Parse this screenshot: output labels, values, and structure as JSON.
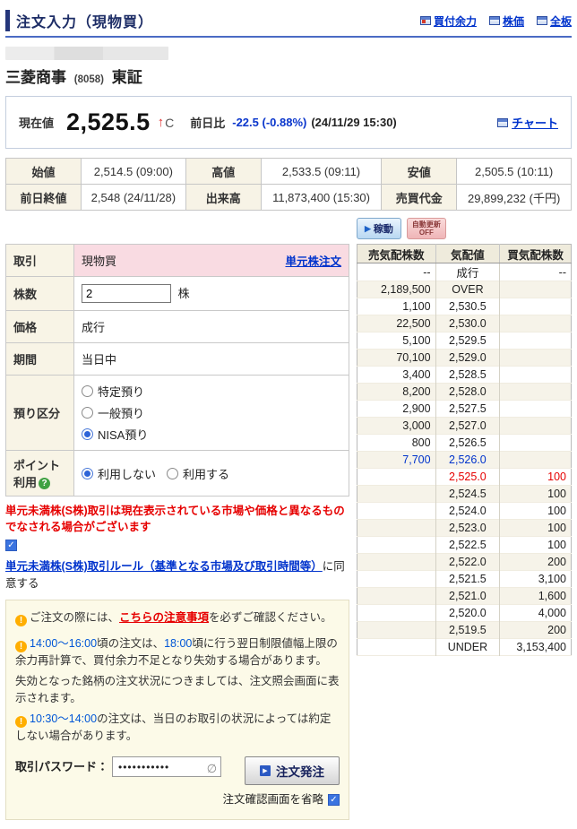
{
  "header": {
    "title": "注文入力（現物買）",
    "links": [
      {
        "label": "買付余力",
        "cls": "win-red"
      },
      {
        "label": "株価",
        "cls": ""
      },
      {
        "label": "全板",
        "cls": ""
      }
    ]
  },
  "stock": {
    "name": "三菱商事",
    "code": "(8058)",
    "market": "東証"
  },
  "price": {
    "current_label": "現在値",
    "value": "2,525.5",
    "tick_arrow": "↑",
    "tick_flag": "C",
    "change_label": "前日比",
    "change": "-22.5 (-0.88%)",
    "timestamp": "(24/11/29 15:30)",
    "chart_link": "チャート"
  },
  "quote": {
    "rows": [
      [
        "始値",
        "2,514.5 (09:00)",
        "高値",
        "2,533.5 (09:11)",
        "安値",
        "2,505.5 (10:11)"
      ],
      [
        "前日終値",
        "2,548 (24/11/28)",
        "出来高",
        "11,873,400 (15:30)",
        "売買代金",
        "29,899,232 (千円)"
      ]
    ]
  },
  "controls": {
    "run_label": "稼動",
    "auto_update_line1": "自動更新",
    "auto_update_line2": "OFF"
  },
  "form": {
    "trade_label": "取引",
    "trade_value": "現物買",
    "unit_order_link": "単元株注文",
    "qty_label": "株数",
    "qty_value": "2",
    "qty_unit": "株",
    "price_label": "価格",
    "price_value": "成行",
    "period_label": "期間",
    "period_value": "当日中",
    "deposit_label": "預り区分",
    "deposit_options": [
      {
        "label": "特定預り",
        "cls": ""
      },
      {
        "label": "一般預り",
        "cls": ""
      },
      {
        "label": "NISA預り",
        "cls": "checked"
      }
    ],
    "point_label": "ポイント利用",
    "point_help": "?",
    "point_options": [
      {
        "label": "利用しない",
        "cls": "checked"
      },
      {
        "label": "利用する",
        "cls": ""
      }
    ]
  },
  "warning": {
    "text": "単元未満株(S株)取引は現在表示されている市場や価格と異なるものでなされる場合がございます"
  },
  "agreement": {
    "link": "単元未満株(S株)取引ルール（基準となる市場及び取引時間等）",
    "suffix": "に同意する"
  },
  "notes": {
    "line1_pre": "ご注文の際には、",
    "line1_link": "こちらの注意事項",
    "line1_post": "を必ずご確認ください。",
    "line2_time1": "14:00～16:00",
    "line2_a": "頃の注文は、",
    "line2_time2": "18:00",
    "line2_b": "頃に行う翌日制限値幅上限の余力再計算で、買付余力不足となり失効する場合があります。",
    "line3": "失効となった銘柄の注文状況につきましては、注文照会画面に表示されます。",
    "line4_time": "10:30～14:00",
    "line4_a": "の注文は、当日のお取引の状況によっては約定しない場合があります。"
  },
  "submit": {
    "password_label": "取引パスワード：",
    "password_value": "•••••••••••",
    "eye_icon": "∅",
    "submit_label": "注文発注",
    "skip_confirm_label": "注文確認画面を省略"
  },
  "order_book": {
    "headers": {
      "sell": "売気配株数",
      "price": "気配値",
      "buy": "買気配株数"
    },
    "rows": [
      {
        "sell": "--",
        "price": "成行",
        "buy": "--",
        "cls": ""
      },
      {
        "sell": "2,189,500",
        "price": "OVER",
        "buy": "",
        "cls": ""
      },
      {
        "sell": "1,100",
        "price": "2,530.5",
        "buy": "",
        "cls": ""
      },
      {
        "sell": "22,500",
        "price": "2,530.0",
        "buy": "",
        "cls": ""
      },
      {
        "sell": "5,100",
        "price": "2,529.5",
        "buy": "",
        "cls": ""
      },
      {
        "sell": "70,100",
        "price": "2,529.0",
        "buy": "",
        "cls": ""
      },
      {
        "sell": "3,400",
        "price": "2,528.5",
        "buy": "",
        "cls": ""
      },
      {
        "sell": "8,200",
        "price": "2,528.0",
        "buy": "",
        "cls": ""
      },
      {
        "sell": "2,900",
        "price": "2,527.5",
        "buy": "",
        "cls": ""
      },
      {
        "sell": "3,000",
        "price": "2,527.0",
        "buy": "",
        "cls": ""
      },
      {
        "sell": "800",
        "price": "2,526.5",
        "buy": "",
        "cls": ""
      },
      {
        "sell": "7,700",
        "price": "2,526.0",
        "buy": "",
        "cls": "best-ask"
      },
      {
        "sell": "",
        "price": "2,525.0",
        "buy": "100",
        "cls": "best-bid"
      },
      {
        "sell": "",
        "price": "2,524.5",
        "buy": "100",
        "cls": ""
      },
      {
        "sell": "",
        "price": "2,524.0",
        "buy": "100",
        "cls": ""
      },
      {
        "sell": "",
        "price": "2,523.0",
        "buy": "100",
        "cls": ""
      },
      {
        "sell": "",
        "price": "2,522.5",
        "buy": "100",
        "cls": ""
      },
      {
        "sell": "",
        "price": "2,522.0",
        "buy": "200",
        "cls": ""
      },
      {
        "sell": "",
        "price": "2,521.5",
        "buy": "3,100",
        "cls": ""
      },
      {
        "sell": "",
        "price": "2,521.0",
        "buy": "1,600",
        "cls": ""
      },
      {
        "sell": "",
        "price": "2,520.0",
        "buy": "4,000",
        "cls": ""
      },
      {
        "sell": "",
        "price": "2,519.5",
        "buy": "200",
        "cls": ""
      },
      {
        "sell": "",
        "price": "UNDER",
        "buy": "3,153,400",
        "cls": ""
      }
    ]
  }
}
